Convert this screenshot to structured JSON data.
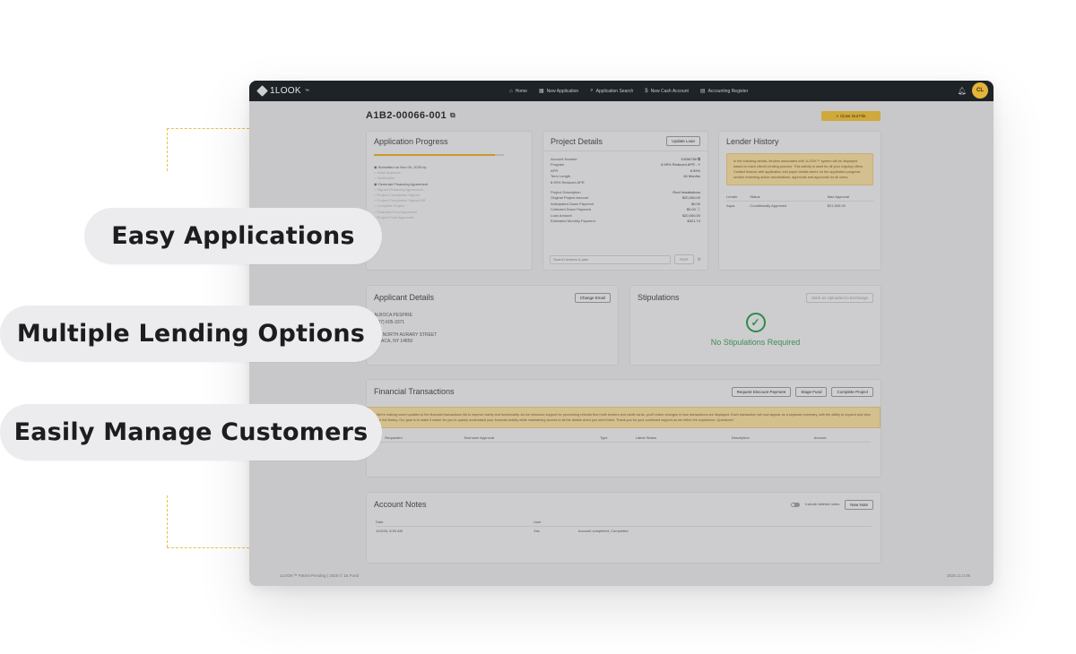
{
  "pills": {
    "easy_applications": "Easy Applications",
    "multiple_lending": "Multiple Lending Options",
    "manage_customers": "Easily Manage Customers"
  },
  "app": {
    "brand": "1LOOK",
    "brand_tm": "™",
    "nav": {
      "home": "Home",
      "new_application": "New Application",
      "application_search": "Application Search",
      "new_cash_account": "New Cash Account",
      "accounting_register": "Accounting Register"
    },
    "avatar_initials": "CL",
    "application_id": "A1B2-00066-001",
    "close_out_file": "Close Out File",
    "progress_fraction": 0.93
  },
  "cards": {
    "application_progress": {
      "title": "Application Progress",
      "steps": [
        "Submitted on Nov 09, 2025 by",
        "Initial Approval",
        "Verification",
        "Generate Financing Agreement",
        "Signed Financing Agreement",
        "Project Completion Signed",
        "Project Completion Signed Off",
        "Complete Project",
        "Financial Fund Approved",
        "Project Fund Approved"
      ]
    },
    "project_details": {
      "title": "Project Details",
      "update_loan": "Update Loan",
      "rows": [
        {
          "label": "Account Number",
          "value": "10056789 ⧉"
        },
        {
          "label": "Program",
          "value": "8.99% Reduced APR - Y"
        },
        {
          "label": "APR",
          "value": "8.99%"
        },
        {
          "label": "Term Length",
          "value": "84 Months"
        },
        {
          "label": "8.99% Reduced APR",
          "value": ""
        },
        {
          "label": "",
          "value": ""
        },
        {
          "label": "Project Description",
          "value": "Roof Installations"
        },
        {
          "label": "Original Project Amount",
          "value": "$20,000.00"
        },
        {
          "label": "Anticipated Down Payment",
          "value": "$0.00"
        },
        {
          "label": "Collected Down Payment",
          "value": "$0.00 ⓘ"
        },
        {
          "label": "Loan Amount",
          "value": "$20,000.00"
        },
        {
          "label": "Estimated Monthly Payment",
          "value": "$321.74"
        }
      ],
      "search_placeholder": "Search lenders & jobs",
      "next_label": "Next"
    },
    "lender_history": {
      "title": "Lender History",
      "alert": "In the following details, lenders associated with 1LOOK™ system will be displayed based on each client's lending process. This activity is used for all your ongoing offers. Contact finance with application and payer details where on the application progress section reviewing active cancellations, approvals and approvals for all users.",
      "columns": [
        "Lender",
        "Status",
        "Max Approval"
      ],
      "rows": [
        {
          "lender": "Aqua",
          "status": "Conditionally Approved",
          "max": "$21,500.00"
        }
      ]
    },
    "applicant_details": {
      "title": "Applicant Details",
      "change_email": "Change Email",
      "name": "ALBOCA PESPIRE",
      "phone": "(607) 605-3371",
      "street": "123 NORTH AURARY STREET",
      "city": "ITHACA, NY 14850"
    },
    "stipulations": {
      "title": "Stipulations",
      "button": "Mark as Uploaded to Exchange",
      "message": "No Stipulations Required"
    },
    "financial_transactions": {
      "title": "Financial Transactions",
      "buttons": [
        "Request Discount Payment",
        "Stage Fund",
        "Complete Project"
      ],
      "alert": "We're making some updates to the financial transactions list to improve clarity and functionality. As we introduce support for processing refunds from both lenders and credit cards, you'll notice changes in how transactions are displayed. Each transaction will now appear as a separate summary, with the ability to expand and view the full history. Our goal is to make it easier for you to quickly understand your financial activity while maintaining access to all the details when you need them. Thank you for your continued support as we refine the experience. Questions?",
      "columns": [
        "#",
        "Requested",
        "Borrower Approval",
        "Type",
        "Latest Status",
        "Description",
        "Amount"
      ]
    },
    "account_notes": {
      "title": "Account Notes",
      "include_deleted": "Include deleted notes",
      "new_note": "New Note",
      "columns": [
        "Date",
        "User"
      ],
      "rows": [
        {
          "date": "11/9/25, 8:54 AM",
          "user": "Zac",
          "note": "Account completed, Completed"
        }
      ]
    }
  },
  "footer": {
    "left": "1LOOK™ Patent Pending | 2025 © 1& Fund",
    "right": "2025.11.0.05"
  }
}
